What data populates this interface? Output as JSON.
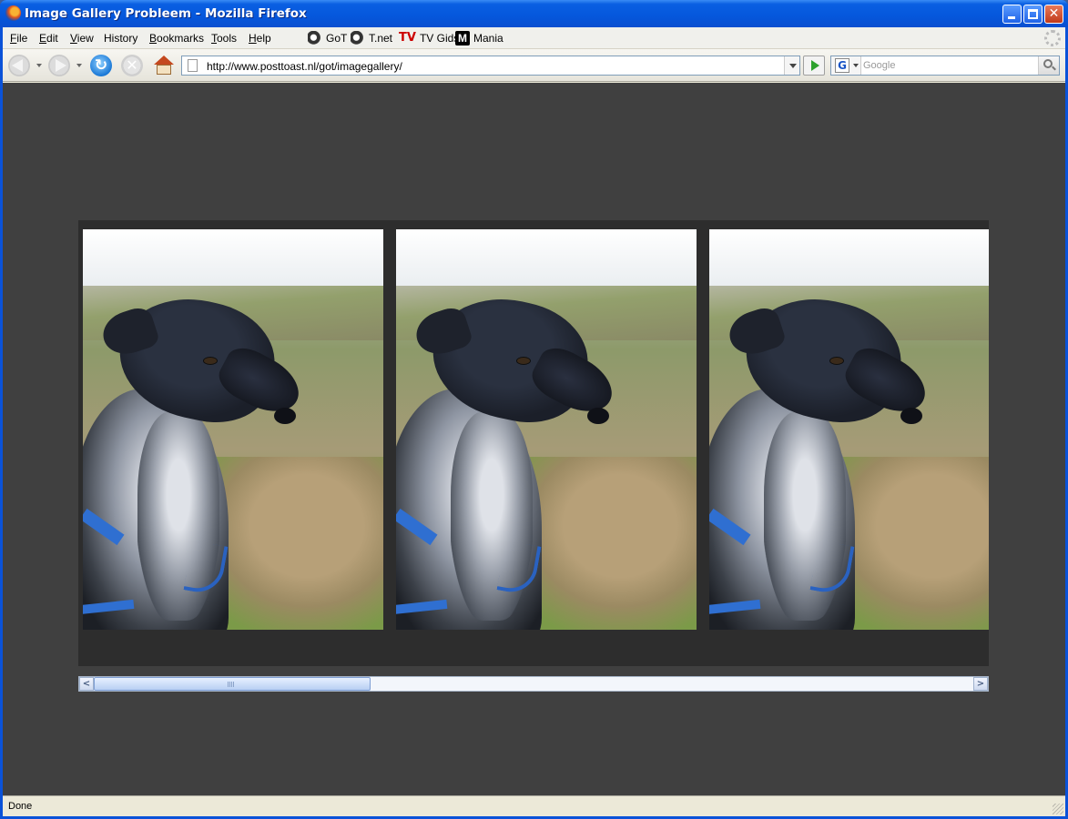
{
  "window": {
    "title": "Image Gallery Probleem - Mozilla Firefox",
    "controls": {
      "minimize": "_",
      "maximize": "□",
      "close": "✕"
    }
  },
  "menubar": {
    "items": [
      {
        "label": "File",
        "accel": "F"
      },
      {
        "label": "Edit",
        "accel": "E"
      },
      {
        "label": "View",
        "accel": "V"
      },
      {
        "label": "History",
        "accel": "s"
      },
      {
        "label": "Bookmarks",
        "accel": "B"
      },
      {
        "label": "Tools",
        "accel": "T"
      },
      {
        "label": "Help",
        "accel": "H"
      }
    ],
    "bookmarks": [
      {
        "label": "GoT",
        "icon": "got-icon"
      },
      {
        "label": "T.net",
        "icon": "tnet-icon"
      },
      {
        "label": "TV Gids",
        "icon": "tv-icon",
        "icon_text": "TV"
      },
      {
        "label": "Mania",
        "icon": "mania-icon",
        "icon_text": "M"
      }
    ]
  },
  "navbar": {
    "url": "http://www.posttoast.nl/got/imagegallery/",
    "search_placeholder": "Google",
    "search_engine_letter": "G",
    "reload_glyph": "↻",
    "stop_glyph": "✕"
  },
  "gallery": {
    "photo_count": 3,
    "background": "#404040",
    "scroll_position": 0.0
  },
  "scrollbar": {
    "left_glyph": "<",
    "right_glyph": ">"
  },
  "status": {
    "text": "Done"
  }
}
